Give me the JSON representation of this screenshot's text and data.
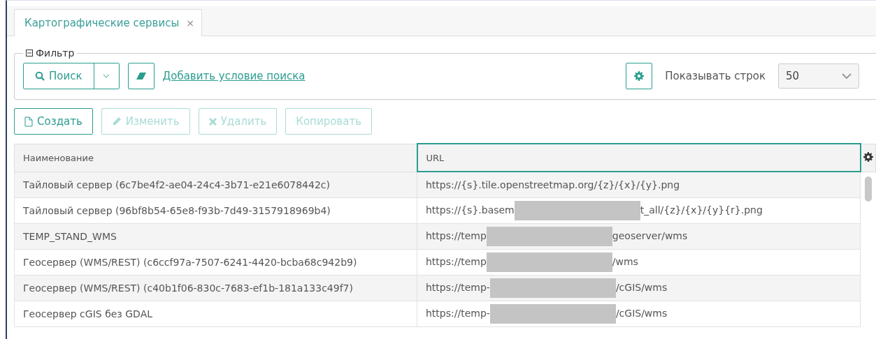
{
  "tabs": [
    {
      "label": "Картографические сервисы",
      "selected": true,
      "close": "×"
    }
  ],
  "filter": {
    "legend": "Фильтр",
    "expanded": true,
    "search_button": "Поиск",
    "add_condition_link": "Добавить условие поиска",
    "rows_label": "Показывать строк",
    "rows_value": "50"
  },
  "toolbar": [
    {
      "label": "Создать",
      "kind": "file",
      "disabled": false
    },
    {
      "label": "Изменить",
      "kind": "pencil",
      "disabled": true
    },
    {
      "label": "Удалить",
      "kind": "cross",
      "disabled": true
    },
    {
      "label": "Копировать",
      "kind": "plain",
      "disabled": true
    }
  ],
  "table": {
    "columns": [
      {
        "label": "Наименование",
        "selected": false
      },
      {
        "label": "URL",
        "selected": true
      }
    ],
    "rows": [
      {
        "name": "Тайловый сервер (6c7be4f2-ae04-24c4-3b71-e21e6078442c)",
        "url": {
          "before": "https://{s}.tile.openstreetmap.org/{z}/{x}/{y}.png",
          "redacted": false
        }
      },
      {
        "name": "Тайловый сервер (96bf8b54-65e8-f93b-7d49-3157918969b4)",
        "url": {
          "before": "https://{s}.basem",
          "redacted": true,
          "after": "t_all/{z}/{x}/{y}{r}.png"
        }
      },
      {
        "name": "TEMP_STAND_WMS",
        "url": {
          "before": "https://temp",
          "redacted": true,
          "after": "geoserver/wms"
        }
      },
      {
        "name": "Геосервер (WMS/REST) (c6ccf97a-7507-6241-4420-bcba68c942b9)",
        "url": {
          "before": "https://temp",
          "redacted": true,
          "after": "/wms"
        }
      },
      {
        "name": "Геосервер (WMS/REST) (c40b1f06-830c-7683-ef1b-181a133c49f7)",
        "url": {
          "before": "https://temp-",
          "redacted": true,
          "after": "/cGIS/wms"
        }
      },
      {
        "name": "Геосервер cGIS без GDAL",
        "url": {
          "before": "https://temp-",
          "redacted": true,
          "after": "/cGIS/wms"
        }
      }
    ]
  }
}
